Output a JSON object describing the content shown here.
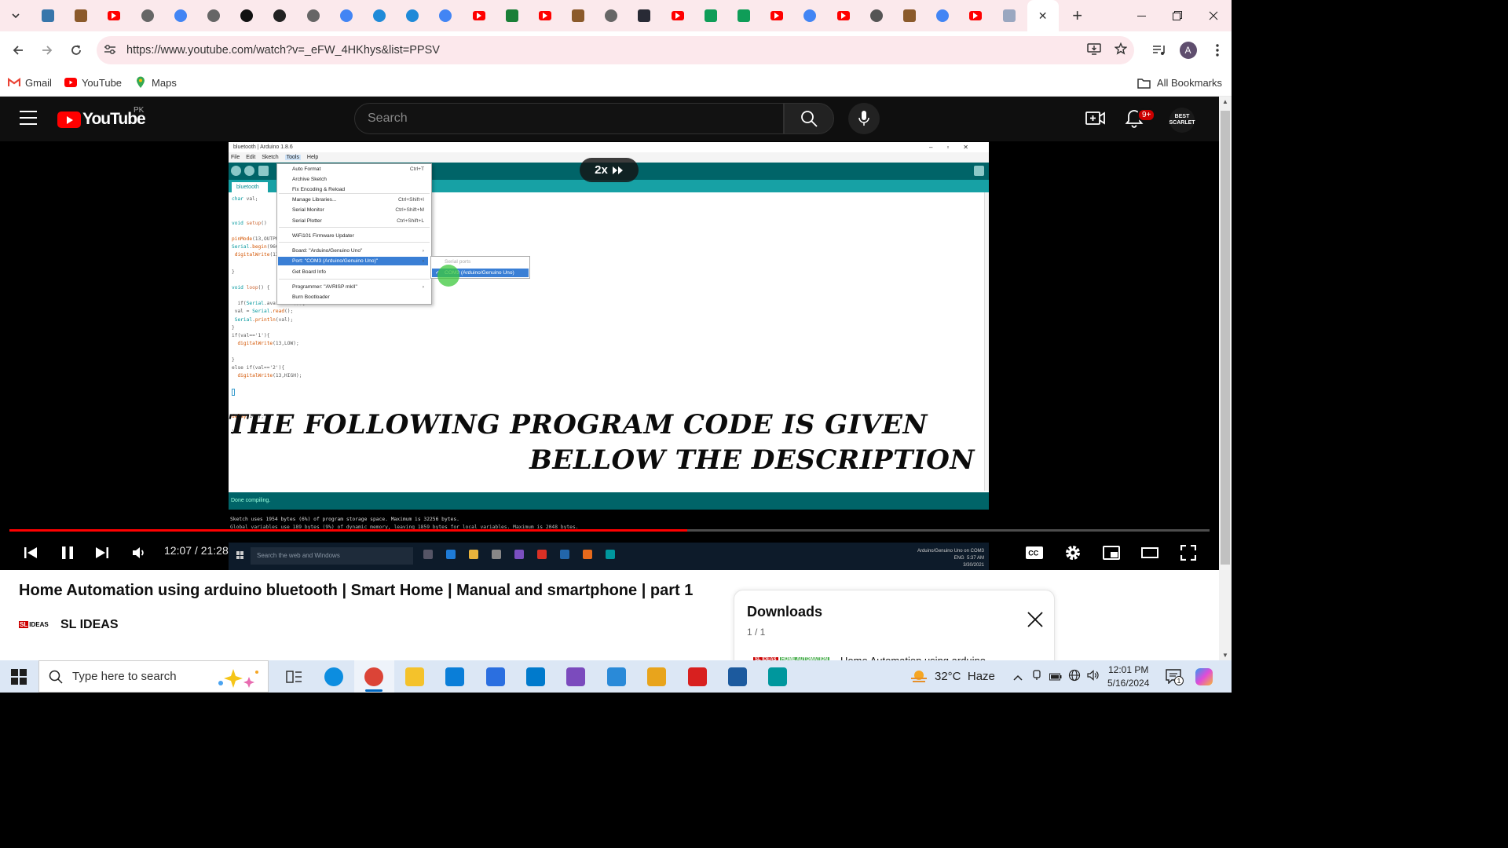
{
  "browser": {
    "tabs": [
      {
        "icon": "python-icon",
        "color": "#3776ab"
      },
      {
        "icon": "m-logo-icon",
        "color": "#8b5a2b"
      },
      {
        "icon": "youtube-icon",
        "color": "#ff0000"
      },
      {
        "icon": "globe-icon",
        "color": "#666666"
      },
      {
        "icon": "google-icon",
        "color": "#4285f4"
      },
      {
        "icon": "globe-icon",
        "color": "#666666"
      },
      {
        "icon": "github-icon",
        "color": "#111111"
      },
      {
        "icon": "openai-icon",
        "color": "#222222"
      },
      {
        "icon": "globe-icon",
        "color": "#666666"
      },
      {
        "icon": "google-icon",
        "color": "#4285f4"
      },
      {
        "icon": "edge-c-icon",
        "color": "#1f8ad8"
      },
      {
        "icon": "edge-c-icon",
        "color": "#1f8ad8"
      },
      {
        "icon": "google-icon",
        "color": "#4285f4"
      },
      {
        "icon": "youtube-icon",
        "color": "#ff0000"
      },
      {
        "icon": "w-logo-icon",
        "color": "#1a7f37"
      },
      {
        "icon": "youtube-icon",
        "color": "#ff0000"
      },
      {
        "icon": "m-logo-icon",
        "color": "#8b5a2b"
      },
      {
        "icon": "globe-icon",
        "color": "#666666"
      },
      {
        "icon": "w3schools-icon",
        "color": "#282a35"
      },
      {
        "icon": "youtube-icon",
        "color": "#ff0000"
      },
      {
        "icon": "drive-icon",
        "color": "#0f9d58"
      },
      {
        "icon": "drive-icon",
        "color": "#0f9d58"
      },
      {
        "icon": "youtube-icon",
        "color": "#ff0000"
      },
      {
        "icon": "google-icon",
        "color": "#4285f4"
      },
      {
        "icon": "youtube-icon",
        "color": "#ff0000"
      },
      {
        "icon": "whatsapp-icon",
        "color": "#555555"
      },
      {
        "icon": "m-logo-icon",
        "color": "#8b5a2b"
      },
      {
        "icon": "google-icon",
        "color": "#4285f4"
      },
      {
        "icon": "youtube-icon",
        "color": "#ff0000"
      },
      {
        "icon": "document-icon",
        "color": "#9aa7c0"
      }
    ],
    "active_tab_close": "✕",
    "url": "https://www.youtube.com/watch?v=_eFW_4HKhys&list=PPSV",
    "profile_initial": "A",
    "bookmarks": [
      {
        "label": "Gmail",
        "icon": "gmail-icon"
      },
      {
        "label": "YouTube",
        "icon": "youtube-icon"
      },
      {
        "label": "Maps",
        "icon": "maps-icon"
      }
    ],
    "all_bookmarks": "All Bookmarks"
  },
  "youtube": {
    "logo_text": "YouTube",
    "country": "PK",
    "search_placeholder": "Search",
    "notification_count": "9+",
    "avatar_text": "BEST SCARLET"
  },
  "video": {
    "speed_label": "2x",
    "time": "12:07 / 21:28",
    "progress_fraction": 0.565,
    "overlay_line1": "THE FOLLOWING PROGRAM CODE IS GIVEN",
    "overlay_line2": "BELLOW THE DESCRIPTION",
    "ide": {
      "window_title": "bluetooth | Arduino 1.8.6",
      "menu": [
        "File",
        "Edit",
        "Sketch",
        "Tools",
        "Help"
      ],
      "tab": "bluetooth",
      "tools_menu": [
        {
          "label": "Auto Format",
          "shortcut": "Ctrl+T"
        },
        {
          "label": "Archive Sketch",
          "shortcut": ""
        },
        {
          "label": "Fix Encoding & Reload",
          "shortcut": ""
        },
        {
          "label": "Manage Libraries...",
          "shortcut": "Ctrl+Shift+I"
        },
        {
          "label": "Serial Monitor",
          "shortcut": "Ctrl+Shift+M"
        },
        {
          "label": "Serial Plotter",
          "shortcut": "Ctrl+Shift+L"
        },
        {
          "label": "WiFi101 Firmware Updater",
          "shortcut": ""
        },
        {
          "label": "Board: \"Arduino/Genuino Uno\"",
          "shortcut": "›"
        },
        {
          "label": "Port: \"COM3 (Arduino/Genuino Uno)\"",
          "shortcut": "›"
        },
        {
          "label": "Get Board Info",
          "shortcut": ""
        },
        {
          "label": "Programmer: \"AVRISP mkII\"",
          "shortcut": "›"
        },
        {
          "label": "Burn Bootloader",
          "shortcut": ""
        }
      ],
      "submenu_header": "Serial ports",
      "submenu_item": "COM3 (Arduino/Genuino Uno)",
      "status": "Done compiling.",
      "console": [
        "Sketch uses 1954 bytes (6%) of program storage space. Maximum is 32256 bytes.",
        "Global variables use 189 bytes (9%) of dynamic memory, leaving 1859 bytes for local variables. Maximum is 2048 bytes."
      ],
      "taskbar_search": "Search the web and Windows",
      "tray_board": "Arduino/Genuino Uno on COM3",
      "tray_time": "5:37 AM",
      "tray_date": "3/30/2021",
      "tray_lang": "ENG"
    }
  },
  "details": {
    "title": "Home Automation using arduino bluetooth | Smart Home | Manual and smartphone | part 1",
    "channel": "SL IDEAS",
    "channel_logo": "SL IDEAS"
  },
  "downloads": {
    "title": "Downloads",
    "count": "1 / 1",
    "item_title": "Home Automation using arduino",
    "item_thumb": "SL IDEAS HOME AUTOMATION"
  },
  "taskbar": {
    "search_placeholder": "Type here to search",
    "apps": [
      {
        "icon": "task-view-icon",
        "color": "#333333"
      },
      {
        "icon": "edge-icon",
        "color": "#0c8de0"
      },
      {
        "icon": "chrome-icon",
        "color": "#db4437"
      },
      {
        "icon": "file-explorer-icon",
        "color": "#f4c22b"
      },
      {
        "icon": "onedrive-icon",
        "color": "#0a7ed8"
      },
      {
        "icon": "todo-icon",
        "color": "#2b6fe0"
      },
      {
        "icon": "vscode-icon",
        "color": "#007acc"
      },
      {
        "icon": "visual-studio-icon",
        "color": "#7b4bbd"
      },
      {
        "icon": "paint-icon",
        "color": "#2a8ad8"
      },
      {
        "icon": "snipping-icon",
        "color": "#e8a41c"
      },
      {
        "icon": "acrobat-icon",
        "color": "#d8201f"
      },
      {
        "icon": "virtualbox-icon",
        "color": "#1c5a9e"
      },
      {
        "icon": "arduino-icon",
        "color": "#00979d"
      }
    ],
    "active_app_index": 2,
    "weather_temp": "32°C",
    "weather_desc": "Haze",
    "time": "12:01 PM",
    "date": "5/16/2024",
    "notification_count": "1"
  }
}
